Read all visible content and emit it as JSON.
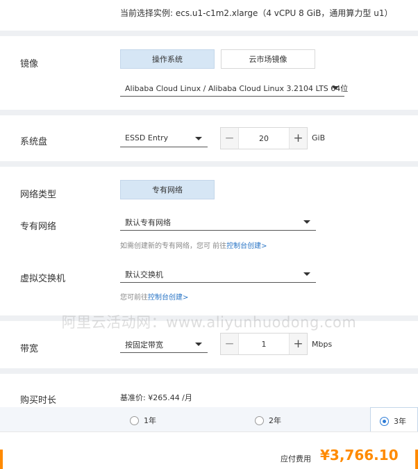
{
  "instance_line": "当前选择实例: ecs.u1-c1m2.xlarge（4 vCPU 8 GiB，通用算力型 u1）",
  "image": {
    "label": "镜像",
    "tabs": [
      {
        "label": "操作系统",
        "active": true
      },
      {
        "label": "云市场镜像",
        "active": false
      }
    ],
    "os_select": "Alibaba Cloud Linux / Alibaba Cloud Linux 3.2104 LTS 64位"
  },
  "system_disk": {
    "label": "系统盘",
    "type": "ESSD Entry",
    "size": "20",
    "unit": "GiB",
    "minus": "−",
    "plus": "+"
  },
  "network": {
    "type_label": "网络类型",
    "type_tab": "专有网络",
    "vpc_label": "专有网络",
    "vpc_select": "默认专有网络",
    "vpc_hint": "如需创建新的专有网络，您可 前往",
    "vpc_hint_link": "控制台创建>",
    "vswitch_label": "虚拟交换机",
    "vswitch_select": "默认交换机",
    "vswitch_hint": "您可前往",
    "vswitch_hint_link": "控制台创建>"
  },
  "watermark": "阿里云活动网：www.aliyunhuodong.com",
  "bandwidth": {
    "label": "带宽",
    "type": "按固定带宽",
    "value": "1",
    "unit": "Mbps",
    "minus": "−",
    "plus": "+"
  },
  "duration": {
    "label": "购买时长",
    "base_price": "基准价: ¥265.44 /月",
    "options": [
      {
        "label": "1年",
        "checked": false
      },
      {
        "label": "2年",
        "checked": false
      },
      {
        "label": "3年",
        "checked": true
      }
    ]
  },
  "footer": {
    "fee_label": "应付费用",
    "fee_value": "¥3,766.10"
  },
  "colors": {
    "accent_blue": "#2b7bd6",
    "price_orange": "#ff8a00",
    "tab_active_bg": "#d6e6f5"
  }
}
